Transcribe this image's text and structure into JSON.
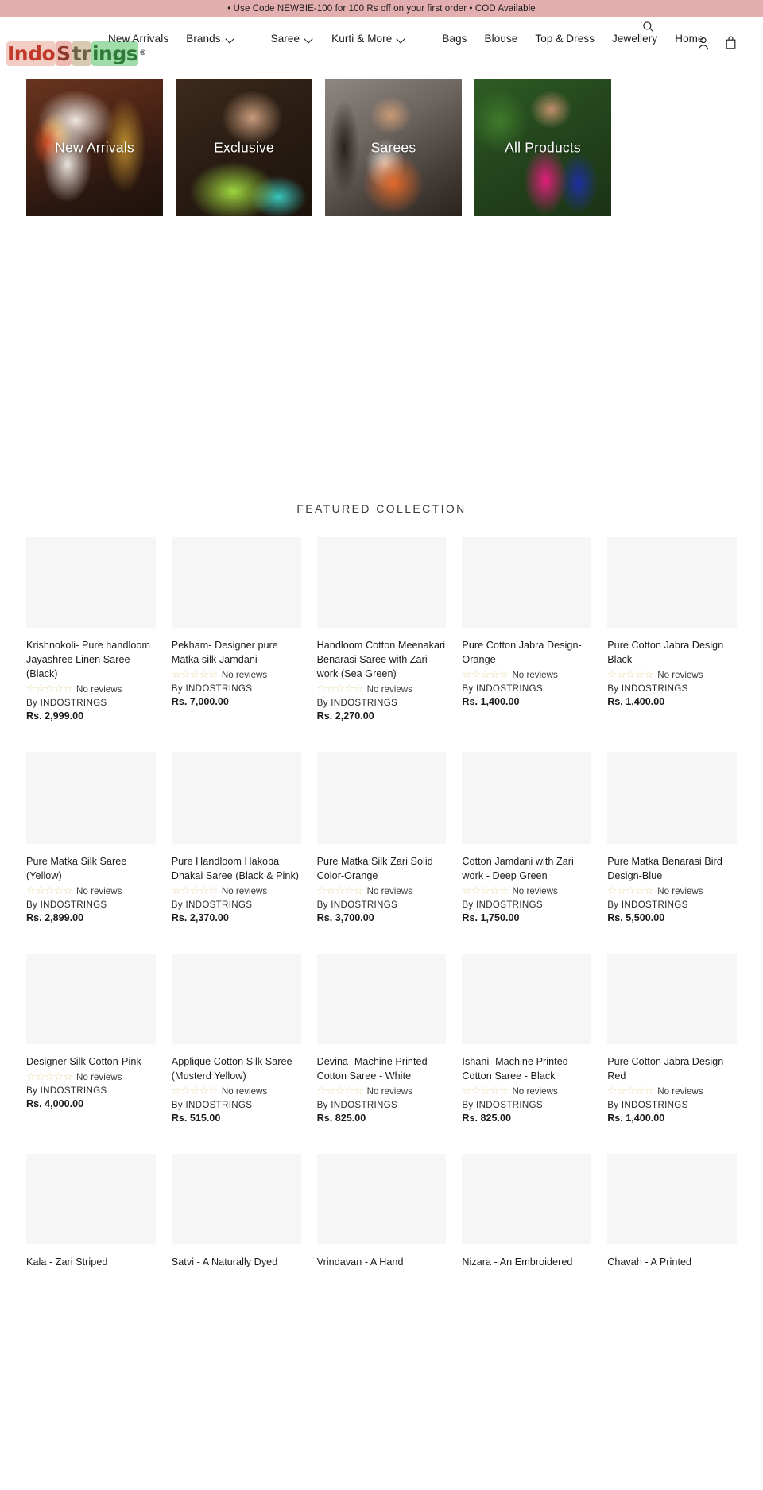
{
  "announcement": {
    "text": "• Use Code NEWBIE-100 for 100 Rs off on your first order • COD Available"
  },
  "header": {
    "logo": {
      "seg1": "Indo",
      "seg2": "S",
      "seg3": "tr",
      "seg4": "ings",
      "registered": "®"
    },
    "nav": [
      {
        "label": "New Arrivals",
        "has_dropdown": false
      },
      {
        "label": "Brands",
        "has_dropdown": true
      },
      {
        "label": "Saree",
        "has_dropdown": true
      },
      {
        "label": "Kurti & More",
        "has_dropdown": true
      },
      {
        "label": "Bags",
        "has_dropdown": false
      },
      {
        "label": "Blouse",
        "has_dropdown": false
      },
      {
        "label": "Top & Dress",
        "has_dropdown": false
      },
      {
        "label": "Jewellery",
        "has_dropdown": false
      },
      {
        "label": "Home",
        "has_dropdown": false
      }
    ],
    "icons": {
      "search": "search-icon",
      "account": "user-account-icon",
      "cart": "shopping-bag-icon"
    }
  },
  "banners": [
    {
      "label": "New Arrivals"
    },
    {
      "label": "Exclusive"
    },
    {
      "label": "Sarees"
    },
    {
      "label": "All Products"
    }
  ],
  "featured": {
    "title": "FEATURED COLLECTION",
    "reviews_text": "No reviews",
    "vendor_prefix": "By",
    "star_glyph": "☆",
    "star_color": "#e8d8a8",
    "products": [
      {
        "title": "Krishnokoli- Pure handloom Jayashree Linen Saree (Black)",
        "reviews": "No reviews",
        "vendor": "By  INDOSTRINGS",
        "price": "Rs. 2,999.00"
      },
      {
        "title": "Pekham- Designer pure Matka silk Jamdani",
        "reviews": "No reviews",
        "vendor": "By  INDOSTRINGS",
        "price": "Rs. 7,000.00"
      },
      {
        "title": "Handloom Cotton Meenakari Benarasi Saree with Zari work (Sea Green)",
        "reviews": "No reviews",
        "vendor": "By  INDOSTRINGS",
        "price": "Rs. 2,270.00"
      },
      {
        "title": "Pure Cotton Jabra Design- Orange",
        "reviews": "No reviews",
        "vendor": "By  INDOSTRINGS",
        "price": "Rs. 1,400.00"
      },
      {
        "title": "Pure Cotton Jabra Design Black",
        "reviews": "No reviews",
        "vendor": "By  INDOSTRINGS",
        "price": "Rs. 1,400.00"
      },
      {
        "title": "Pure Matka Silk Saree (Yellow)",
        "reviews": "No reviews",
        "vendor": "By  INDOSTRINGS",
        "price": "Rs. 2,899.00"
      },
      {
        "title": "Pure Handloom Hakoba Dhakai Saree (Black & Pink)",
        "reviews": "No reviews",
        "vendor": "By  INDOSTRINGS",
        "price": "Rs. 2,370.00"
      },
      {
        "title": "Pure Matka Silk Zari Solid Color-Orange",
        "reviews": "No reviews",
        "vendor": "By  INDOSTRINGS",
        "price": "Rs. 3,700.00"
      },
      {
        "title": "Cotton Jamdani with Zari work - Deep Green",
        "reviews": "No reviews",
        "vendor": "By  INDOSTRINGS",
        "price": "Rs. 1,750.00"
      },
      {
        "title": "Pure Matka Benarasi Bird Design-Blue",
        "reviews": "No reviews",
        "vendor": "By  INDOSTRINGS",
        "price": "Rs. 5,500.00"
      },
      {
        "title": "Designer Silk Cotton-Pink",
        "reviews": "No reviews",
        "vendor": "By  INDOSTRINGS",
        "price": "Rs. 4,000.00"
      },
      {
        "title": "Applique Cotton Silk Saree (Musterd Yellow)",
        "reviews": "No reviews",
        "vendor": "By  INDOSTRINGS",
        "price": "Rs. 515.00"
      },
      {
        "title": "Devina- Machine Printed Cotton Saree - White",
        "reviews": "No reviews",
        "vendor": "By  INDOSTRINGS",
        "price": "Rs. 825.00"
      },
      {
        "title": "Ishani- Machine Printed Cotton Saree - Black",
        "reviews": "No reviews",
        "vendor": "By  INDOSTRINGS",
        "price": "Rs. 825.00"
      },
      {
        "title": "Pure Cotton Jabra Design- Red",
        "reviews": "No reviews",
        "vendor": "By  INDOSTRINGS",
        "price": "Rs. 1,400.00"
      },
      {
        "title": "Kala - Zari Striped",
        "reviews": "",
        "vendor": "",
        "price": ""
      },
      {
        "title": "Satvi - A Naturally Dyed",
        "reviews": "",
        "vendor": "",
        "price": ""
      },
      {
        "title": "Vrindavan - A Hand",
        "reviews": "",
        "vendor": "",
        "price": ""
      },
      {
        "title": "Nizara - An Embroidered",
        "reviews": "",
        "vendor": "",
        "price": ""
      },
      {
        "title": "Chavah - A Printed",
        "reviews": "",
        "vendor": "",
        "price": ""
      }
    ]
  }
}
